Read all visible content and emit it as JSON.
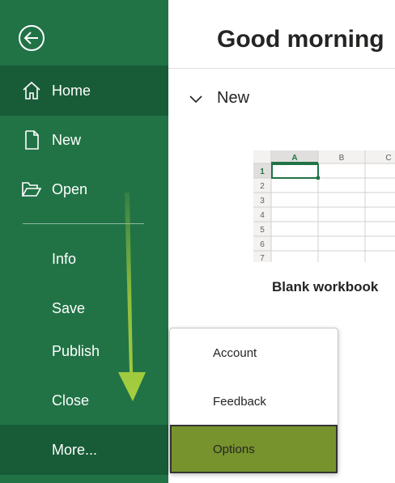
{
  "sidebar": {
    "items": [
      {
        "label": "Home",
        "icon": "home-icon"
      },
      {
        "label": "New",
        "icon": "new-document-icon"
      },
      {
        "label": "Open",
        "icon": "open-folder-icon"
      },
      {
        "label": "Info"
      },
      {
        "label": "Save"
      },
      {
        "label": "Publish"
      },
      {
        "label": "Close"
      },
      {
        "label": "More..."
      }
    ],
    "active_item": "Home",
    "bg_color": "#217346",
    "active_color": "#185c37"
  },
  "main": {
    "greeting": "Good morning",
    "section_title": "New",
    "template": {
      "label": "Blank workbook",
      "columns": [
        "A",
        "B",
        "C"
      ],
      "rows": [
        "1",
        "2",
        "3",
        "4",
        "5",
        "6",
        "7"
      ]
    }
  },
  "more_menu": {
    "items": [
      {
        "label": "Account"
      },
      {
        "label": "Feedback"
      },
      {
        "label": "Options"
      }
    ],
    "highlighted": "Options",
    "highlight_color": "#77932d"
  },
  "annotation": {
    "arrow_color": "#9bc53d"
  }
}
